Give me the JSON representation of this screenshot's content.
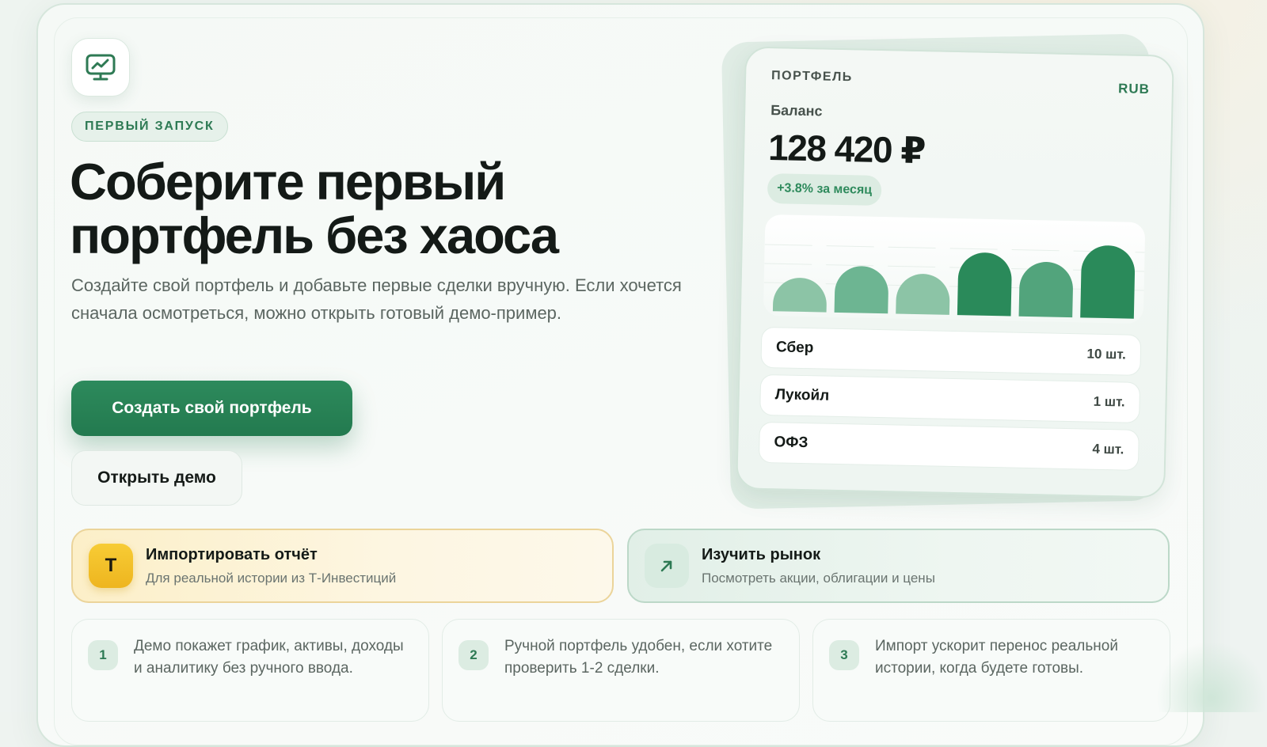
{
  "hero": {
    "badge": "ПЕРВЫЙ ЗАПУСК",
    "title": "Соберите первый портфель без хаоса",
    "subtitle": "Создайте свой портфель и добавьте первые сделки вручную. Если хочется сначала осмотреться, можно открыть готовый демо-пример.",
    "primary_button": "Создать свой портфель",
    "secondary_button": "Открыть демо",
    "app_icon": "monitor-chart-icon"
  },
  "portfolio_card": {
    "label": "ПОРТФЕЛЬ",
    "currency": "RUB",
    "balance_label": "Баланс",
    "balance": "128 420 ₽",
    "change": "+3.8% за месяц",
    "assets": [
      {
        "name": "Сбер",
        "qty": "10 шт."
      },
      {
        "name": "Лукойл",
        "qty": "1 шт."
      },
      {
        "name": "ОФЗ",
        "qty": "4 шт."
      }
    ]
  },
  "chart_data": {
    "type": "bar",
    "values": [
      42,
      58,
      50,
      78,
      68,
      90
    ],
    "colors": [
      "#8cc4a6",
      "#6db592",
      "#8cc4a6",
      "#2a8a5a",
      "#52a47c",
      "#2a8a5a"
    ],
    "ylim": [
      0,
      100
    ],
    "grid": true
  },
  "actions": {
    "import": {
      "badge": "T",
      "title": "Импортировать отчёт",
      "desc": "Для реальной истории из Т-Инвестиций",
      "accent": "#f2c230"
    },
    "market": {
      "icon": "arrow-up-right-icon",
      "title": "Изучить рынок",
      "desc": "Посмотреть акции, облигации и цены",
      "accent": "#2e7a54"
    }
  },
  "steps": [
    {
      "num": "1",
      "text": "Демо покажет график, активы, доходы и аналитику без ручного ввода."
    },
    {
      "num": "2",
      "text": "Ручной портфель удобен, если хотите проверить 1-2 сделки."
    },
    {
      "num": "3",
      "text": "Импорт ускорит перенос реальной истории, когда будете готовы."
    }
  ]
}
